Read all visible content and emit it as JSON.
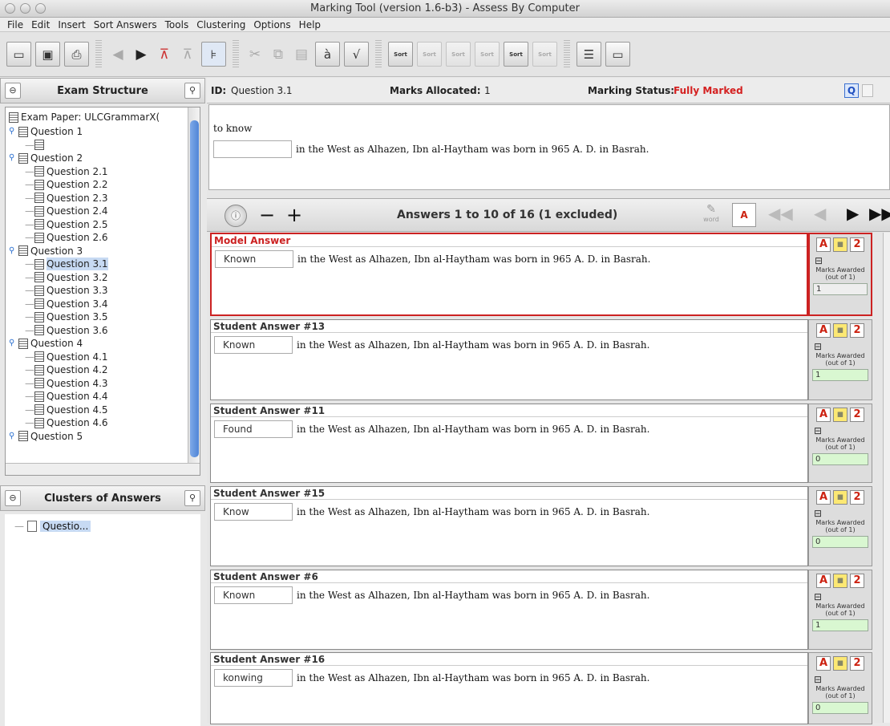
{
  "window": {
    "title": "Marking Tool (version 1.6-b3) - Assess By Computer"
  },
  "menu": [
    "File",
    "Edit",
    "Insert",
    "Sort Answers",
    "Tools",
    "Clustering",
    "Options",
    "Help"
  ],
  "toolbar": {
    "icons": [
      "open-icon",
      "save-icon",
      "print-icon",
      "back-icon",
      "forward-icon",
      "tree-expand-icon",
      "tree-collapse-icon",
      "structure-icon",
      "cut-icon",
      "copy-icon",
      "paste-icon",
      "accent-icon",
      "formula-icon",
      "sort-1-icon",
      "sort-icon",
      "sort-a-icon",
      "sort-lock-icon",
      "sort-hash-icon",
      "sort-id-icon",
      "export-icon",
      "print-preview-icon"
    ],
    "sort_label": "Sort"
  },
  "exam_structure": {
    "title": "Exam Structure",
    "root": "Exam Paper: ULCGrammarX(",
    "items": [
      {
        "label": "Question 1",
        "level": 1
      },
      {
        "label": "",
        "level": 2
      },
      {
        "label": "Question 2",
        "level": 1
      },
      {
        "label": "Question 2.1",
        "level": 2
      },
      {
        "label": "Question 2.2",
        "level": 2
      },
      {
        "label": "Question 2.3",
        "level": 2
      },
      {
        "label": "Question 2.4",
        "level": 2
      },
      {
        "label": "Question 2.5",
        "level": 2
      },
      {
        "label": "Question 2.6",
        "level": 2
      },
      {
        "label": "Question 3",
        "level": 1
      },
      {
        "label": "Question 3.1",
        "level": 2,
        "selected": true
      },
      {
        "label": "Question 3.2",
        "level": 2
      },
      {
        "label": "Question 3.3",
        "level": 2
      },
      {
        "label": "Question 3.4",
        "level": 2
      },
      {
        "label": "Question 3.5",
        "level": 2
      },
      {
        "label": "Question 3.6",
        "level": 2
      },
      {
        "label": "Question 4",
        "level": 1
      },
      {
        "label": "Question 4.1",
        "level": 2
      },
      {
        "label": "Question 4.2",
        "level": 2
      },
      {
        "label": "Question 4.3",
        "level": 2
      },
      {
        "label": "Question 4.4",
        "level": 2
      },
      {
        "label": "Question 4.5",
        "level": 2
      },
      {
        "label": "Question 4.6",
        "level": 2
      },
      {
        "label": "Question 5",
        "level": 1
      }
    ]
  },
  "clusters": {
    "title": "Clusters of Answers",
    "items": [
      "Questio..."
    ]
  },
  "question": {
    "id_label": "ID:",
    "id": "Question 3.1",
    "marks_label": "Marks Allocated:",
    "marks": "1",
    "status_label": "Marking Status:",
    "status": "Fully Marked",
    "status_color": "#d42020",
    "prompt": "to know",
    "sentence": "in the West as Alhazen, Ibn al-Haytham was born in 965 A. D. in Basrah."
  },
  "answers_nav": {
    "summary": "Answers 1 to 10 of 16 (1 excluded)",
    "word_label": "word"
  },
  "answers": [
    {
      "header": "Model Answer",
      "fill": "Known",
      "text": "in the West as Alhazen, Ibn al-Haytham was born in 965 A. D. in Basrah.",
      "mark": "1",
      "model": true
    },
    {
      "header": "Student Answer #13",
      "fill": "Known",
      "text": "in the West as Alhazen, Ibn al-Haytham was born in 965 A. D. in Basrah.",
      "mark": "1"
    },
    {
      "header": "Student Answer #11",
      "fill": "Found",
      "text": "in the West as Alhazen, Ibn al-Haytham was born in 965 A. D. in Basrah.",
      "mark": "0"
    },
    {
      "header": "Student Answer #15",
      "fill": "Know",
      "text": "in the West as Alhazen, Ibn al-Haytham was born in 965 A. D. in Basrah.",
      "mark": "0"
    },
    {
      "header": "Student Answer #6",
      "fill": "Known",
      "text": "in the West as Alhazen, Ibn al-Haytham was born in 965 A. D. in Basrah.",
      "mark": "1"
    },
    {
      "header": "Student Answer #16",
      "fill": "konwing",
      "text": "in the West as Alhazen, Ibn al-Haytham was born in 965 A. D. in Basrah.",
      "mark": "0"
    }
  ],
  "marks_awarded_label": "Marks Awarded",
  "out_of_label": "(out of 1)"
}
